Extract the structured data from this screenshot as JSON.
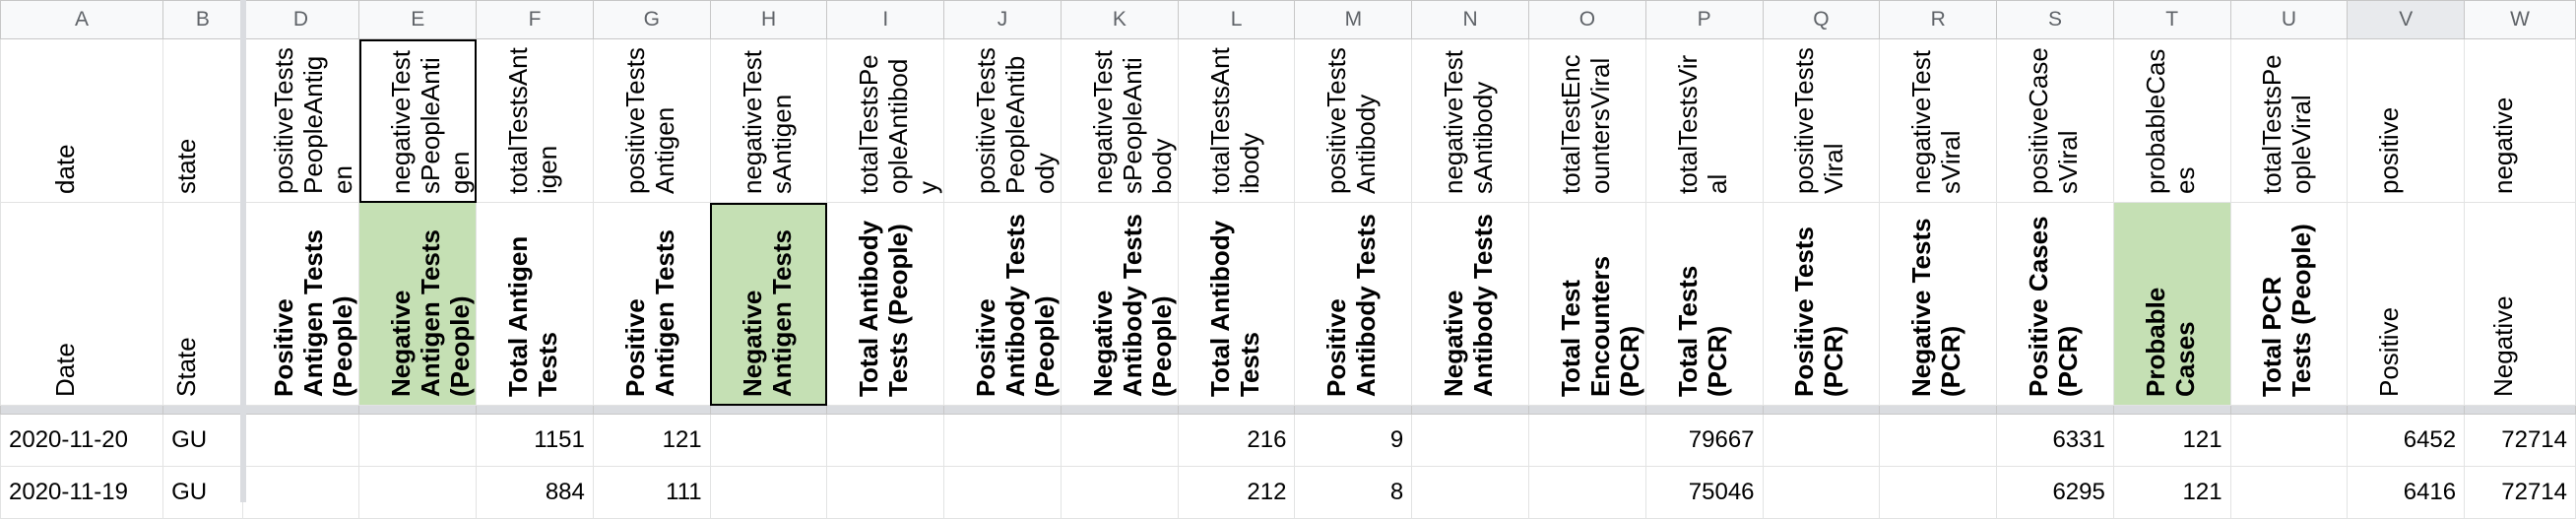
{
  "column_letters": [
    "A",
    "B",
    "D",
    "E",
    "F",
    "G",
    "H",
    "I",
    "J",
    "K",
    "L",
    "M",
    "N",
    "O",
    "P",
    "Q",
    "R",
    "S",
    "T",
    "U",
    "V",
    "W"
  ],
  "field_names": [
    "date",
    "state",
    "positiveTestsPeopleAntigen",
    "negativeTestsPeopleAntigen",
    "totalTestsAntigen",
    "positiveTestsAntigen",
    "negativeTestsAntigen",
    "totalTestsPeopleAntibody",
    "positiveTestsPeopleAntibody",
    "negativeTestsPeopleAntibody",
    "totalTestsAntibody",
    "positiveTestsAntibody",
    "negativeTestsAntibody",
    "totalTestEncountersViral",
    "totalTestsViral",
    "positiveTestsViral",
    "negativeTestsViral",
    "positiveCasesViral",
    "probableCases",
    "totalTestsPeopleViral",
    "positive",
    "negative"
  ],
  "labels": [
    "Date",
    "State",
    "Positive Antigen Tests (People)",
    "Negative Antigen Tests (People)",
    "Total Antigen Tests",
    "Positive Antigen Tests",
    "Negative Antigen Tests",
    "Total Antibody Tests (People)",
    "Positive Antibody Tests (People)",
    "Negative Antibody Tests (People)",
    "Total Antibody Tests",
    "Positive Antibody Tests",
    "Negative Antibody Tests",
    "Total Test Encounters (PCR)",
    "Total Tests (PCR)",
    "Positive Tests (PCR)",
    "Negative Tests (PCR)",
    "Positive Cases (PCR)",
    "Probable Cases",
    "Total PCR Tests (People)",
    "Positive",
    "Negative"
  ],
  "rows": [
    [
      "2020-11-20",
      "GU",
      "",
      "",
      "1151",
      "121",
      "",
      "",
      "",
      "",
      "216",
      "9",
      "",
      "",
      "79667",
      "",
      "",
      "6331",
      "121",
      "",
      "6452",
      "72714"
    ],
    [
      "2020-11-19",
      "GU",
      "",
      "",
      "884",
      "111",
      "",
      "",
      "",
      "",
      "212",
      "8",
      "",
      "",
      "75046",
      "",
      "",
      "6295",
      "121",
      "",
      "6416",
      "72714"
    ]
  ]
}
